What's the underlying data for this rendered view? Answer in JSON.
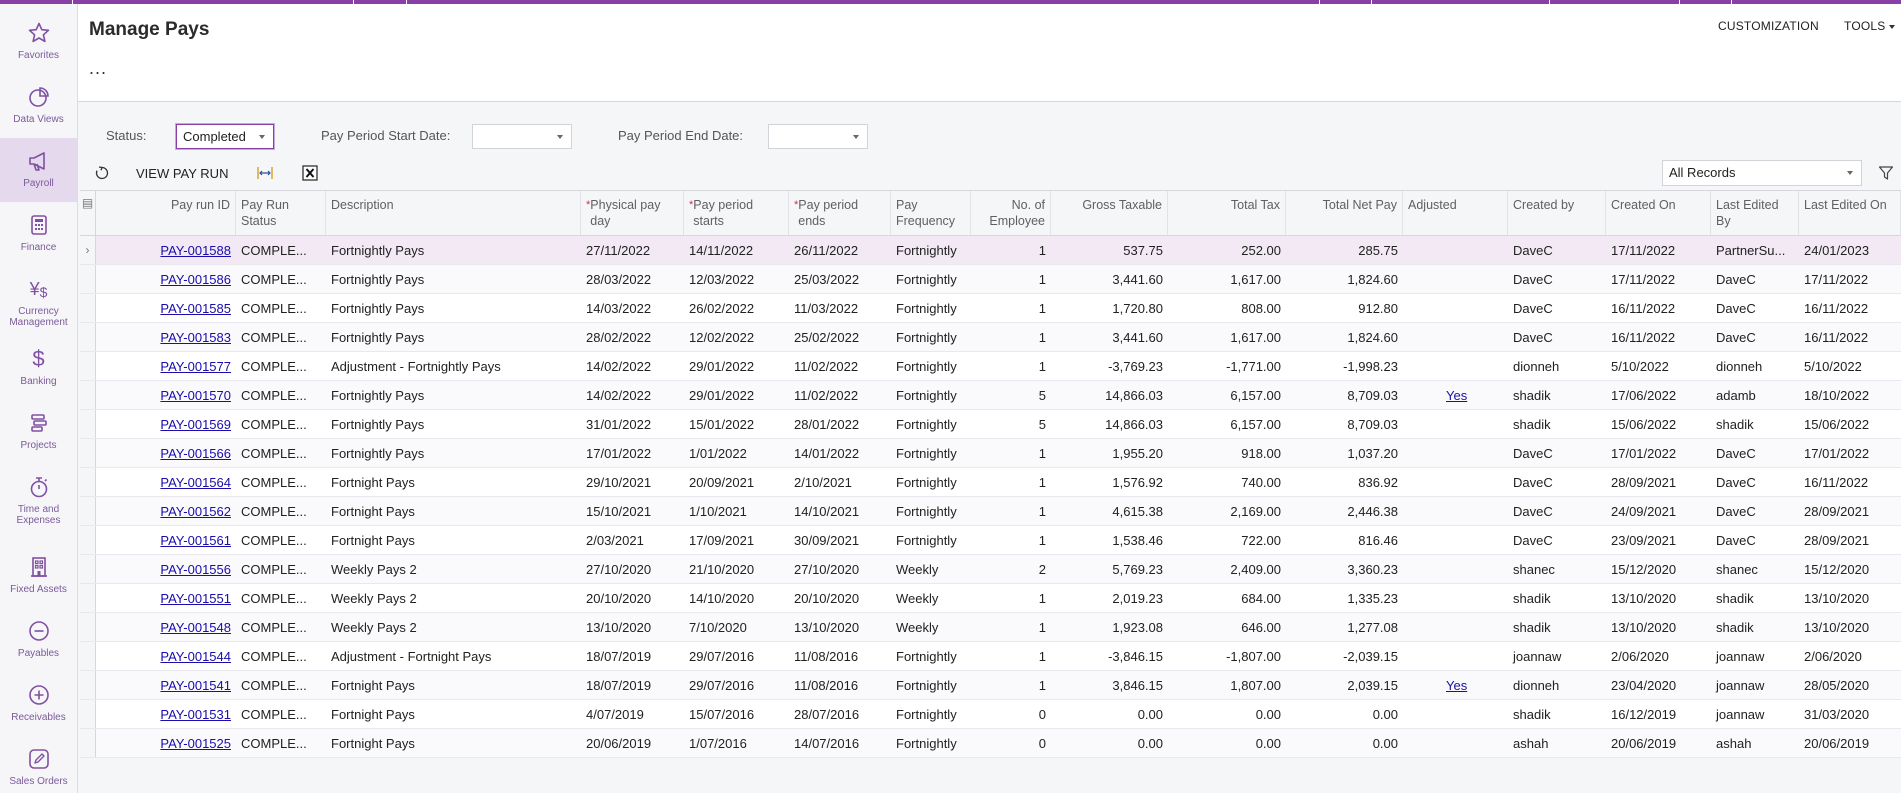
{
  "sidebar": {
    "items": [
      {
        "label": "Favorites",
        "icon": "star-icon"
      },
      {
        "label": "Data Views",
        "icon": "pie-chart-icon"
      },
      {
        "label": "Payroll",
        "icon": "megaphone-icon",
        "active": true
      },
      {
        "label": "Finance",
        "icon": "calculator-icon"
      },
      {
        "label": "Currency Management",
        "icon": "currency-icon"
      },
      {
        "label": "Banking",
        "icon": "dollar-icon"
      },
      {
        "label": "Projects",
        "icon": "projects-icon"
      },
      {
        "label": "Time and Expenses",
        "icon": "stopwatch-icon"
      },
      {
        "label": "Fixed Assets",
        "icon": "building-icon"
      },
      {
        "label": "Payables",
        "icon": "minus-circle-icon"
      },
      {
        "label": "Receivables",
        "icon": "plus-circle-icon"
      },
      {
        "label": "Sales Orders",
        "icon": "pencil-icon"
      }
    ]
  },
  "header": {
    "title": "Manage Pays",
    "more": "...",
    "customization": "CUSTOMIZATION",
    "tools": "TOOLS"
  },
  "filters": {
    "status_label": "Status:",
    "status_value": "Completed",
    "start_label": "Pay Period Start Date:",
    "start_value": "",
    "end_label": "Pay Period End Date:",
    "end_value": ""
  },
  "toolbar": {
    "refresh_icon": "refresh-icon",
    "view_pay_run": "VIEW PAY RUN",
    "fit_columns_icon": "fit-columns-icon",
    "export_excel_icon": "excel-icon",
    "records_filter": "All Records",
    "filter_icon": "filter-icon"
  },
  "grid": {
    "columns": [
      {
        "key": "id",
        "label": "Pay run ID",
        "required": false
      },
      {
        "key": "status",
        "label": "Pay Run Status",
        "required": false
      },
      {
        "key": "desc",
        "label": "Description",
        "required": false
      },
      {
        "key": "payday",
        "label": "Physical pay day",
        "required": true
      },
      {
        "key": "start",
        "label": "Pay period starts",
        "required": true
      },
      {
        "key": "end",
        "label": "Pay period ends",
        "required": true
      },
      {
        "key": "freq",
        "label": "Pay Frequency",
        "required": false
      },
      {
        "key": "emp",
        "label": "No. of Employee",
        "required": false
      },
      {
        "key": "gross",
        "label": "Gross Taxable",
        "required": false
      },
      {
        "key": "tax",
        "label": "Total Tax",
        "required": false
      },
      {
        "key": "net",
        "label": "Total Net Pay",
        "required": false
      },
      {
        "key": "adj",
        "label": "Adjusted",
        "required": false
      },
      {
        "key": "cby",
        "label": "Created by",
        "required": false
      },
      {
        "key": "con",
        "label": "Created On",
        "required": false
      },
      {
        "key": "eby",
        "label": "Last Edited By",
        "required": false
      },
      {
        "key": "eon",
        "label": "Last Edited On",
        "required": false
      }
    ],
    "rows": [
      {
        "id": "PAY-001588",
        "status": "COMPLE...",
        "desc": "Fortnightly Pays",
        "payday": "27/11/2022",
        "start": "14/11/2022",
        "end": "26/11/2022",
        "freq": "Fortnightly",
        "emp": "1",
        "gross": "537.75",
        "tax": "252.00",
        "net": "285.75",
        "adj": "",
        "cby": "DaveC",
        "con": "17/11/2022",
        "eby": "PartnerSu...",
        "eon": "24/01/2023"
      },
      {
        "id": "PAY-001586",
        "status": "COMPLE...",
        "desc": "Fortnightly Pays",
        "payday": "28/03/2022",
        "start": "12/03/2022",
        "end": "25/03/2022",
        "freq": "Fortnightly",
        "emp": "1",
        "gross": "3,441.60",
        "tax": "1,617.00",
        "net": "1,824.60",
        "adj": "",
        "cby": "DaveC",
        "con": "17/11/2022",
        "eby": "DaveC",
        "eon": "17/11/2022"
      },
      {
        "id": "PAY-001585",
        "status": "COMPLE...",
        "desc": "Fortnightly Pays",
        "payday": "14/03/2022",
        "start": "26/02/2022",
        "end": "11/03/2022",
        "freq": "Fortnightly",
        "emp": "1",
        "gross": "1,720.80",
        "tax": "808.00",
        "net": "912.80",
        "adj": "",
        "cby": "DaveC",
        "con": "16/11/2022",
        "eby": "DaveC",
        "eon": "16/11/2022"
      },
      {
        "id": "PAY-001583",
        "status": "COMPLE...",
        "desc": "Fortnightly Pays",
        "payday": "28/02/2022",
        "start": "12/02/2022",
        "end": "25/02/2022",
        "freq": "Fortnightly",
        "emp": "1",
        "gross": "3,441.60",
        "tax": "1,617.00",
        "net": "1,824.60",
        "adj": "",
        "cby": "DaveC",
        "con": "16/11/2022",
        "eby": "DaveC",
        "eon": "16/11/2022"
      },
      {
        "id": "PAY-001577",
        "status": "COMPLE...",
        "desc": "Adjustment - Fortnightly Pays",
        "payday": "14/02/2022",
        "start": "29/01/2022",
        "end": "11/02/2022",
        "freq": "Fortnightly",
        "emp": "1",
        "gross": "-3,769.23",
        "tax": "-1,771.00",
        "net": "-1,998.23",
        "adj": "",
        "cby": "dionneh",
        "con": "5/10/2022",
        "eby": "dionneh",
        "eon": "5/10/2022"
      },
      {
        "id": "PAY-001570",
        "status": "COMPLE...",
        "desc": "Fortnightly Pays",
        "payday": "14/02/2022",
        "start": "29/01/2022",
        "end": "11/02/2022",
        "freq": "Fortnightly",
        "emp": "5",
        "gross": "14,866.03",
        "tax": "6,157.00",
        "net": "8,709.03",
        "adj": "Yes",
        "cby": "shadik",
        "con": "17/06/2022",
        "eby": "adamb",
        "eon": "18/10/2022"
      },
      {
        "id": "PAY-001569",
        "status": "COMPLE...",
        "desc": "Fortnightly Pays",
        "payday": "31/01/2022",
        "start": "15/01/2022",
        "end": "28/01/2022",
        "freq": "Fortnightly",
        "emp": "5",
        "gross": "14,866.03",
        "tax": "6,157.00",
        "net": "8,709.03",
        "adj": "",
        "cby": "shadik",
        "con": "15/06/2022",
        "eby": "shadik",
        "eon": "15/06/2022"
      },
      {
        "id": "PAY-001566",
        "status": "COMPLE...",
        "desc": "Fortnightly Pays",
        "payday": "17/01/2022",
        "start": "1/01/2022",
        "end": "14/01/2022",
        "freq": "Fortnightly",
        "emp": "1",
        "gross": "1,955.20",
        "tax": "918.00",
        "net": "1,037.20",
        "adj": "",
        "cby": "DaveC",
        "con": "17/01/2022",
        "eby": "DaveC",
        "eon": "17/01/2022"
      },
      {
        "id": "PAY-001564",
        "status": "COMPLE...",
        "desc": "Fortnight Pays",
        "payday": "29/10/2021",
        "start": "20/09/2021",
        "end": "2/10/2021",
        "freq": "Fortnightly",
        "emp": "1",
        "gross": "1,576.92",
        "tax": "740.00",
        "net": "836.92",
        "adj": "",
        "cby": "DaveC",
        "con": "28/09/2021",
        "eby": "DaveC",
        "eon": "16/11/2022"
      },
      {
        "id": "PAY-001562",
        "status": "COMPLE...",
        "desc": "Fortnight Pays",
        "payday": "15/10/2021",
        "start": "1/10/2021",
        "end": "14/10/2021",
        "freq": "Fortnightly",
        "emp": "1",
        "gross": "4,615.38",
        "tax": "2,169.00",
        "net": "2,446.38",
        "adj": "",
        "cby": "DaveC",
        "con": "24/09/2021",
        "eby": "DaveC",
        "eon": "28/09/2021"
      },
      {
        "id": "PAY-001561",
        "status": "COMPLE...",
        "desc": "Fortnight Pays",
        "payday": "2/03/2021",
        "start": "17/09/2021",
        "end": "30/09/2021",
        "freq": "Fortnightly",
        "emp": "1",
        "gross": "1,538.46",
        "tax": "722.00",
        "net": "816.46",
        "adj": "",
        "cby": "DaveC",
        "con": "23/09/2021",
        "eby": "DaveC",
        "eon": "28/09/2021"
      },
      {
        "id": "PAY-001556",
        "status": "COMPLE...",
        "desc": "Weekly Pays 2",
        "payday": "27/10/2020",
        "start": "21/10/2020",
        "end": "27/10/2020",
        "freq": "Weekly",
        "emp": "2",
        "gross": "5,769.23",
        "tax": "2,409.00",
        "net": "3,360.23",
        "adj": "",
        "cby": "shanec",
        "con": "15/12/2020",
        "eby": "shanec",
        "eon": "15/12/2020"
      },
      {
        "id": "PAY-001551",
        "status": "COMPLE...",
        "desc": "Weekly Pays 2",
        "payday": "20/10/2020",
        "start": "14/10/2020",
        "end": "20/10/2020",
        "freq": "Weekly",
        "emp": "1",
        "gross": "2,019.23",
        "tax": "684.00",
        "net": "1,335.23",
        "adj": "",
        "cby": "shadik",
        "con": "13/10/2020",
        "eby": "shadik",
        "eon": "13/10/2020"
      },
      {
        "id": "PAY-001548",
        "status": "COMPLE...",
        "desc": "Weekly Pays 2",
        "payday": "13/10/2020",
        "start": "7/10/2020",
        "end": "13/10/2020",
        "freq": "Weekly",
        "emp": "1",
        "gross": "1,923.08",
        "tax": "646.00",
        "net": "1,277.08",
        "adj": "",
        "cby": "shadik",
        "con": "13/10/2020",
        "eby": "shadik",
        "eon": "13/10/2020"
      },
      {
        "id": "PAY-001544",
        "status": "COMPLE...",
        "desc": "Adjustment - Fortnight Pays",
        "payday": "18/07/2019",
        "start": "29/07/2016",
        "end": "11/08/2016",
        "freq": "Fortnightly",
        "emp": "1",
        "gross": "-3,846.15",
        "tax": "-1,807.00",
        "net": "-2,039.15",
        "adj": "",
        "cby": "joannaw",
        "con": "2/06/2020",
        "eby": "joannaw",
        "eon": "2/06/2020"
      },
      {
        "id": "PAY-001541",
        "status": "COMPLE...",
        "desc": "Fortnight Pays",
        "payday": "18/07/2019",
        "start": "29/07/2016",
        "end": "11/08/2016",
        "freq": "Fortnightly",
        "emp": "1",
        "gross": "3,846.15",
        "tax": "1,807.00",
        "net": "2,039.15",
        "adj": "Yes",
        "cby": "dionneh",
        "con": "23/04/2020",
        "eby": "joannaw",
        "eon": "28/05/2020"
      },
      {
        "id": "PAY-001531",
        "status": "COMPLE...",
        "desc": "Fortnight Pays",
        "payday": "4/07/2019",
        "start": "15/07/2016",
        "end": "28/07/2016",
        "freq": "Fortnightly",
        "emp": "0",
        "gross": "0.00",
        "tax": "0.00",
        "net": "0.00",
        "adj": "",
        "cby": "shadik",
        "con": "16/12/2019",
        "eby": "joannaw",
        "eon": "31/03/2020"
      },
      {
        "id": "PAY-001525",
        "status": "COMPLE...",
        "desc": "Fortnight Pays",
        "payday": "20/06/2019",
        "start": "1/07/2016",
        "end": "14/07/2016",
        "freq": "Fortnightly",
        "emp": "0",
        "gross": "0.00",
        "tax": "0.00",
        "net": "0.00",
        "adj": "",
        "cby": "ashah",
        "con": "20/06/2019",
        "eby": "ashah",
        "eon": "20/06/2019"
      }
    ]
  },
  "colors": {
    "accent": "#8a3fa6",
    "selected_row": "#f2e9f5",
    "link": "#1a0dab",
    "required": "#d0304a"
  }
}
